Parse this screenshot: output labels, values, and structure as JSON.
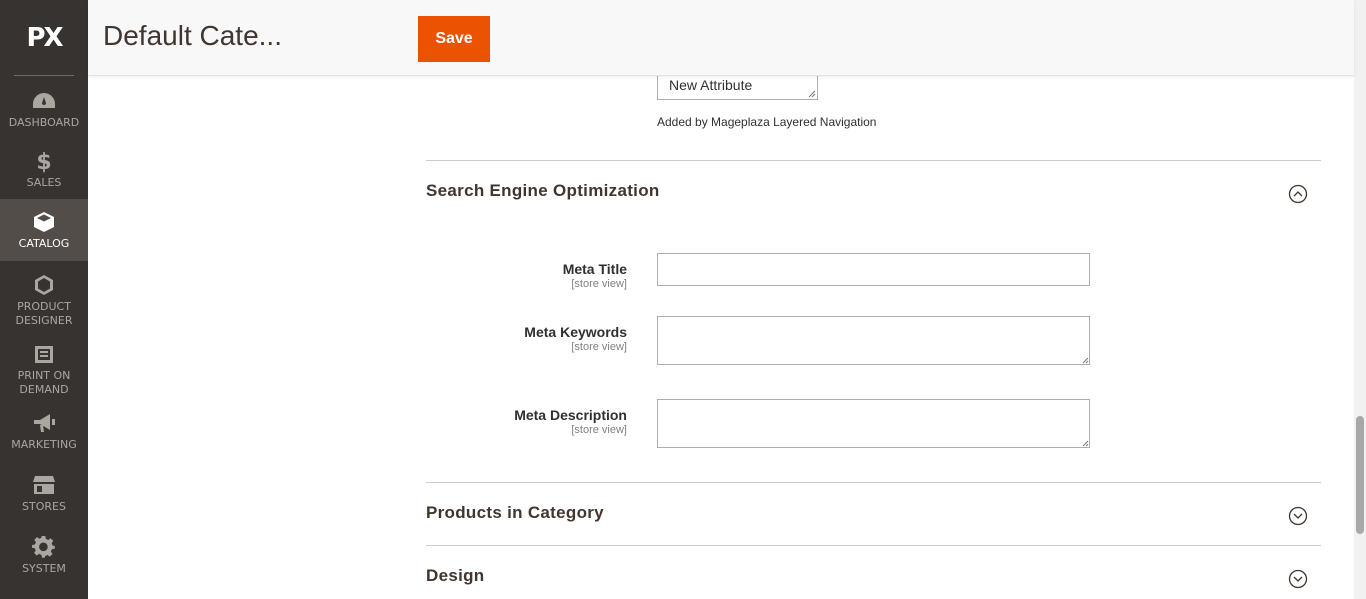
{
  "sidebar": {
    "logo": "PX",
    "items": [
      {
        "label": "DASHBOARD",
        "icon": "dashboard-icon"
      },
      {
        "label": "SALES",
        "icon": "dollar-icon"
      },
      {
        "label": "CATALOG",
        "icon": "box-icon"
      },
      {
        "label": "PRODUCT DESIGNER",
        "icon": "hexagon-icon"
      },
      {
        "label": "PRINT ON DEMAND",
        "icon": "printer-icon"
      },
      {
        "label": "MARKETING",
        "icon": "megaphone-icon"
      },
      {
        "label": "STORES",
        "icon": "store-icon"
      },
      {
        "label": "SYSTEM",
        "icon": "gear-icon"
      }
    ],
    "active": "CATALOG"
  },
  "header": {
    "title": "Default Cate...",
    "save_label": "Save"
  },
  "layered_nav": {
    "selected_option": "New Attribute",
    "note": "Added by Mageplaza Layered Navigation"
  },
  "seo": {
    "title": "Search Engine Optimization",
    "fields": [
      {
        "label": "Meta Title",
        "scope": "[store view]",
        "value": ""
      },
      {
        "label": "Meta Keywords",
        "scope": "[store view]",
        "value": ""
      },
      {
        "label": "Meta Description",
        "scope": "[store view]",
        "value": ""
      }
    ]
  },
  "sections": [
    {
      "title": "Products in Category"
    },
    {
      "title": "Design"
    }
  ],
  "colors": {
    "sidebar_bg": "#373330",
    "active_bg": "#524d49",
    "accent": "#eb5202"
  }
}
